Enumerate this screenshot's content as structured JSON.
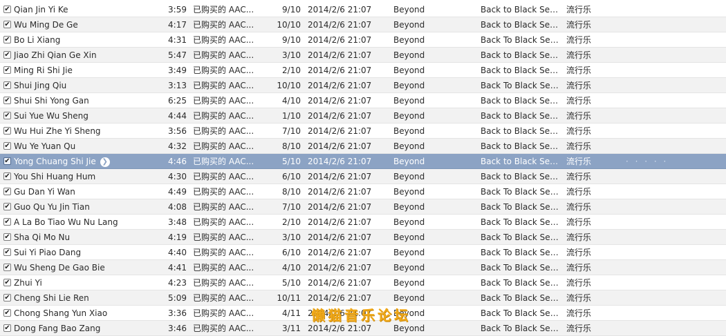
{
  "tracks": [
    {
      "name": "Qian Jin Yi Ke",
      "time": "3:59",
      "kind": "已购买的 AAC...",
      "plays": "9/10",
      "added": "2014/2/6 21:07",
      "artist": "Beyond",
      "album": "Back to Black Series:...",
      "genre": "流行乐"
    },
    {
      "name": "Wu Ming De Ge",
      "time": "4:17",
      "kind": "已购买的 AAC...",
      "plays": "10/10",
      "added": "2014/2/6 21:07",
      "artist": "Beyond",
      "album": "Back to Black Series:...",
      "genre": "流行乐"
    },
    {
      "name": "Bo Li Xiang",
      "time": "4:31",
      "kind": "已购买的 AAC...",
      "plays": "9/10",
      "added": "2014/2/6 21:07",
      "artist": "Beyond",
      "album": "Back To Black Series:...",
      "genre": "流行乐"
    },
    {
      "name": "Jiao Zhi Qian Ge Xin",
      "time": "5:47",
      "kind": "已购买的 AAC...",
      "plays": "3/10",
      "added": "2014/2/6 21:07",
      "artist": "Beyond",
      "album": "Back to Black Series:...",
      "genre": "流行乐"
    },
    {
      "name": "Ming Ri Shi Jie",
      "time": "3:49",
      "kind": "已购买的 AAC...",
      "plays": "2/10",
      "added": "2014/2/6 21:07",
      "artist": "Beyond",
      "album": "Back to Black Series:...",
      "genre": "流行乐"
    },
    {
      "name": "Shui Jing Qiu",
      "time": "3:13",
      "kind": "已购买的 AAC...",
      "plays": "10/10",
      "added": "2014/2/6 21:07",
      "artist": "Beyond",
      "album": "Back To Black Series:...",
      "genre": "流行乐"
    },
    {
      "name": "Shui Shi Yong Gan",
      "time": "6:25",
      "kind": "已购买的 AAC...",
      "plays": "4/10",
      "added": "2014/2/6 21:07",
      "artist": "Beyond",
      "album": "Back to Black Series:...",
      "genre": "流行乐"
    },
    {
      "name": "Sui Yue Wu Sheng",
      "time": "4:44",
      "kind": "已购买的 AAC...",
      "plays": "1/10",
      "added": "2014/2/6 21:07",
      "artist": "Beyond",
      "album": "Back to Black Series:...",
      "genre": "流行乐"
    },
    {
      "name": "Wu Hui Zhe Yi Sheng",
      "time": "3:56",
      "kind": "已购买的 AAC...",
      "plays": "7/10",
      "added": "2014/2/6 21:07",
      "artist": "Beyond",
      "album": "Back to Black Series:...",
      "genre": "流行乐"
    },
    {
      "name": "Wu Ye Yuan Qu",
      "time": "4:32",
      "kind": "已购买的 AAC...",
      "plays": "8/10",
      "added": "2014/2/6 21:07",
      "artist": "Beyond",
      "album": "Back to Black Series:...",
      "genre": "流行乐"
    },
    {
      "name": "Yong Chuang Shi Jie",
      "time": "4:46",
      "kind": "已购买的 AAC...",
      "plays": "5/10",
      "added": "2014/2/6 21:07",
      "artist": "Beyond",
      "album": "Back to Black Series:...",
      "genre": "流行乐",
      "selected": true,
      "dots": "· · · · ·"
    },
    {
      "name": "You Shi Huang Hum",
      "time": "4:30",
      "kind": "已购买的 AAC...",
      "plays": "6/10",
      "added": "2014/2/6 21:07",
      "artist": "Beyond",
      "album": "Back to Black Series:...",
      "genre": "流行乐"
    },
    {
      "name": "Gu Dan Yi Wan",
      "time": "4:49",
      "kind": "已购买的 AAC...",
      "plays": "8/10",
      "added": "2014/2/6 21:07",
      "artist": "Beyond",
      "album": "Back To Black Series:...",
      "genre": "流行乐"
    },
    {
      "name": "Guo Qu Yu Jin Tian",
      "time": "4:08",
      "kind": "已购买的 AAC...",
      "plays": "7/10",
      "added": "2014/2/6 21:07",
      "artist": "Beyond",
      "album": "Back To Black Series:...",
      "genre": "流行乐"
    },
    {
      "name": "A La Bo Tiao Wu Nu Lang",
      "time": "3:48",
      "kind": "已购买的 AAC...",
      "plays": "2/10",
      "added": "2014/2/6 21:07",
      "artist": "Beyond",
      "album": "Back To Black Series:...",
      "genre": "流行乐"
    },
    {
      "name": "Sha Qi Mo Nu",
      "time": "4:19",
      "kind": "已购买的 AAC...",
      "plays": "3/10",
      "added": "2014/2/6 21:07",
      "artist": "Beyond",
      "album": "Back To Black Series:...",
      "genre": "流行乐"
    },
    {
      "name": "Sui Yi Piao Dang",
      "time": "4:40",
      "kind": "已购买的 AAC...",
      "plays": "6/10",
      "added": "2014/2/6 21:07",
      "artist": "Beyond",
      "album": "Back To Black Series:...",
      "genre": "流行乐"
    },
    {
      "name": "Wu Sheng De Gao Bie",
      "time": "4:41",
      "kind": "已购买的 AAC...",
      "plays": "4/10",
      "added": "2014/2/6 21:07",
      "artist": "Beyond",
      "album": "Back To Black Series:...",
      "genre": "流行乐"
    },
    {
      "name": "Zhui Yi",
      "time": "4:23",
      "kind": "已购买的 AAC...",
      "plays": "5/10",
      "added": "2014/2/6 21:07",
      "artist": "Beyond",
      "album": "Back To Black Series:...",
      "genre": "流行乐"
    },
    {
      "name": "Cheng Shi Lie Ren",
      "time": "5:09",
      "kind": "已购买的 AAC...",
      "plays": "10/11",
      "added": "2014/2/6 21:07",
      "artist": "Beyond",
      "album": "Back To Black Series:...",
      "genre": "流行乐"
    },
    {
      "name": "Chong Shang Yun Xiao",
      "time": "3:36",
      "kind": "已购买的 AAC...",
      "plays": "4/11",
      "added": "2014/2/6 21:07",
      "artist": "Beyond",
      "album": "Back To Black Series:...",
      "genre": "流行乐"
    },
    {
      "name": "Dong Fang Bao Zang",
      "time": "3:46",
      "kind": "已购买的 AAC...",
      "plays": "3/11",
      "added": "2014/2/6 21:07",
      "artist": "Beyond",
      "album": "Back To Black Series:...",
      "genre": "流行乐"
    }
  ],
  "check_glyph": "✔",
  "selected_action_glyph": "❯",
  "watermark": "懒猫音乐论坛",
  "colors": {
    "selected_row": "#8ca3c4",
    "stripe": "#f2f2f2",
    "watermark": "#f0a818"
  }
}
